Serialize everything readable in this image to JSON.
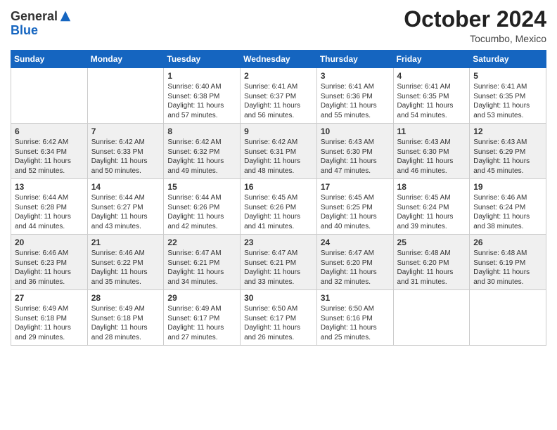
{
  "header": {
    "logo_general": "General",
    "logo_blue": "Blue",
    "month_title": "October 2024",
    "location": "Tocumbo, Mexico"
  },
  "days_of_week": [
    "Sunday",
    "Monday",
    "Tuesday",
    "Wednesday",
    "Thursday",
    "Friday",
    "Saturday"
  ],
  "weeks": [
    [
      {
        "day": "",
        "sunrise": "",
        "sunset": "",
        "daylight": ""
      },
      {
        "day": "",
        "sunrise": "",
        "sunset": "",
        "daylight": ""
      },
      {
        "day": "1",
        "sunrise": "Sunrise: 6:40 AM",
        "sunset": "Sunset: 6:38 PM",
        "daylight": "Daylight: 11 hours and 57 minutes."
      },
      {
        "day": "2",
        "sunrise": "Sunrise: 6:41 AM",
        "sunset": "Sunset: 6:37 PM",
        "daylight": "Daylight: 11 hours and 56 minutes."
      },
      {
        "day": "3",
        "sunrise": "Sunrise: 6:41 AM",
        "sunset": "Sunset: 6:36 PM",
        "daylight": "Daylight: 11 hours and 55 minutes."
      },
      {
        "day": "4",
        "sunrise": "Sunrise: 6:41 AM",
        "sunset": "Sunset: 6:35 PM",
        "daylight": "Daylight: 11 hours and 54 minutes."
      },
      {
        "day": "5",
        "sunrise": "Sunrise: 6:41 AM",
        "sunset": "Sunset: 6:35 PM",
        "daylight": "Daylight: 11 hours and 53 minutes."
      }
    ],
    [
      {
        "day": "6",
        "sunrise": "Sunrise: 6:42 AM",
        "sunset": "Sunset: 6:34 PM",
        "daylight": "Daylight: 11 hours and 52 minutes."
      },
      {
        "day": "7",
        "sunrise": "Sunrise: 6:42 AM",
        "sunset": "Sunset: 6:33 PM",
        "daylight": "Daylight: 11 hours and 50 minutes."
      },
      {
        "day": "8",
        "sunrise": "Sunrise: 6:42 AM",
        "sunset": "Sunset: 6:32 PM",
        "daylight": "Daylight: 11 hours and 49 minutes."
      },
      {
        "day": "9",
        "sunrise": "Sunrise: 6:42 AM",
        "sunset": "Sunset: 6:31 PM",
        "daylight": "Daylight: 11 hours and 48 minutes."
      },
      {
        "day": "10",
        "sunrise": "Sunrise: 6:43 AM",
        "sunset": "Sunset: 6:30 PM",
        "daylight": "Daylight: 11 hours and 47 minutes."
      },
      {
        "day": "11",
        "sunrise": "Sunrise: 6:43 AM",
        "sunset": "Sunset: 6:30 PM",
        "daylight": "Daylight: 11 hours and 46 minutes."
      },
      {
        "day": "12",
        "sunrise": "Sunrise: 6:43 AM",
        "sunset": "Sunset: 6:29 PM",
        "daylight": "Daylight: 11 hours and 45 minutes."
      }
    ],
    [
      {
        "day": "13",
        "sunrise": "Sunrise: 6:44 AM",
        "sunset": "Sunset: 6:28 PM",
        "daylight": "Daylight: 11 hours and 44 minutes."
      },
      {
        "day": "14",
        "sunrise": "Sunrise: 6:44 AM",
        "sunset": "Sunset: 6:27 PM",
        "daylight": "Daylight: 11 hours and 43 minutes."
      },
      {
        "day": "15",
        "sunrise": "Sunrise: 6:44 AM",
        "sunset": "Sunset: 6:26 PM",
        "daylight": "Daylight: 11 hours and 42 minutes."
      },
      {
        "day": "16",
        "sunrise": "Sunrise: 6:45 AM",
        "sunset": "Sunset: 6:26 PM",
        "daylight": "Daylight: 11 hours and 41 minutes."
      },
      {
        "day": "17",
        "sunrise": "Sunrise: 6:45 AM",
        "sunset": "Sunset: 6:25 PM",
        "daylight": "Daylight: 11 hours and 40 minutes."
      },
      {
        "day": "18",
        "sunrise": "Sunrise: 6:45 AM",
        "sunset": "Sunset: 6:24 PM",
        "daylight": "Daylight: 11 hours and 39 minutes."
      },
      {
        "day": "19",
        "sunrise": "Sunrise: 6:46 AM",
        "sunset": "Sunset: 6:24 PM",
        "daylight": "Daylight: 11 hours and 38 minutes."
      }
    ],
    [
      {
        "day": "20",
        "sunrise": "Sunrise: 6:46 AM",
        "sunset": "Sunset: 6:23 PM",
        "daylight": "Daylight: 11 hours and 36 minutes."
      },
      {
        "day": "21",
        "sunrise": "Sunrise: 6:46 AM",
        "sunset": "Sunset: 6:22 PM",
        "daylight": "Daylight: 11 hours and 35 minutes."
      },
      {
        "day": "22",
        "sunrise": "Sunrise: 6:47 AM",
        "sunset": "Sunset: 6:21 PM",
        "daylight": "Daylight: 11 hours and 34 minutes."
      },
      {
        "day": "23",
        "sunrise": "Sunrise: 6:47 AM",
        "sunset": "Sunset: 6:21 PM",
        "daylight": "Daylight: 11 hours and 33 minutes."
      },
      {
        "day": "24",
        "sunrise": "Sunrise: 6:47 AM",
        "sunset": "Sunset: 6:20 PM",
        "daylight": "Daylight: 11 hours and 32 minutes."
      },
      {
        "day": "25",
        "sunrise": "Sunrise: 6:48 AM",
        "sunset": "Sunset: 6:20 PM",
        "daylight": "Daylight: 11 hours and 31 minutes."
      },
      {
        "day": "26",
        "sunrise": "Sunrise: 6:48 AM",
        "sunset": "Sunset: 6:19 PM",
        "daylight": "Daylight: 11 hours and 30 minutes."
      }
    ],
    [
      {
        "day": "27",
        "sunrise": "Sunrise: 6:49 AM",
        "sunset": "Sunset: 6:18 PM",
        "daylight": "Daylight: 11 hours and 29 minutes."
      },
      {
        "day": "28",
        "sunrise": "Sunrise: 6:49 AM",
        "sunset": "Sunset: 6:18 PM",
        "daylight": "Daylight: 11 hours and 28 minutes."
      },
      {
        "day": "29",
        "sunrise": "Sunrise: 6:49 AM",
        "sunset": "Sunset: 6:17 PM",
        "daylight": "Daylight: 11 hours and 27 minutes."
      },
      {
        "day": "30",
        "sunrise": "Sunrise: 6:50 AM",
        "sunset": "Sunset: 6:17 PM",
        "daylight": "Daylight: 11 hours and 26 minutes."
      },
      {
        "day": "31",
        "sunrise": "Sunrise: 6:50 AM",
        "sunset": "Sunset: 6:16 PM",
        "daylight": "Daylight: 11 hours and 25 minutes."
      },
      {
        "day": "",
        "sunrise": "",
        "sunset": "",
        "daylight": ""
      },
      {
        "day": "",
        "sunrise": "",
        "sunset": "",
        "daylight": ""
      }
    ]
  ]
}
